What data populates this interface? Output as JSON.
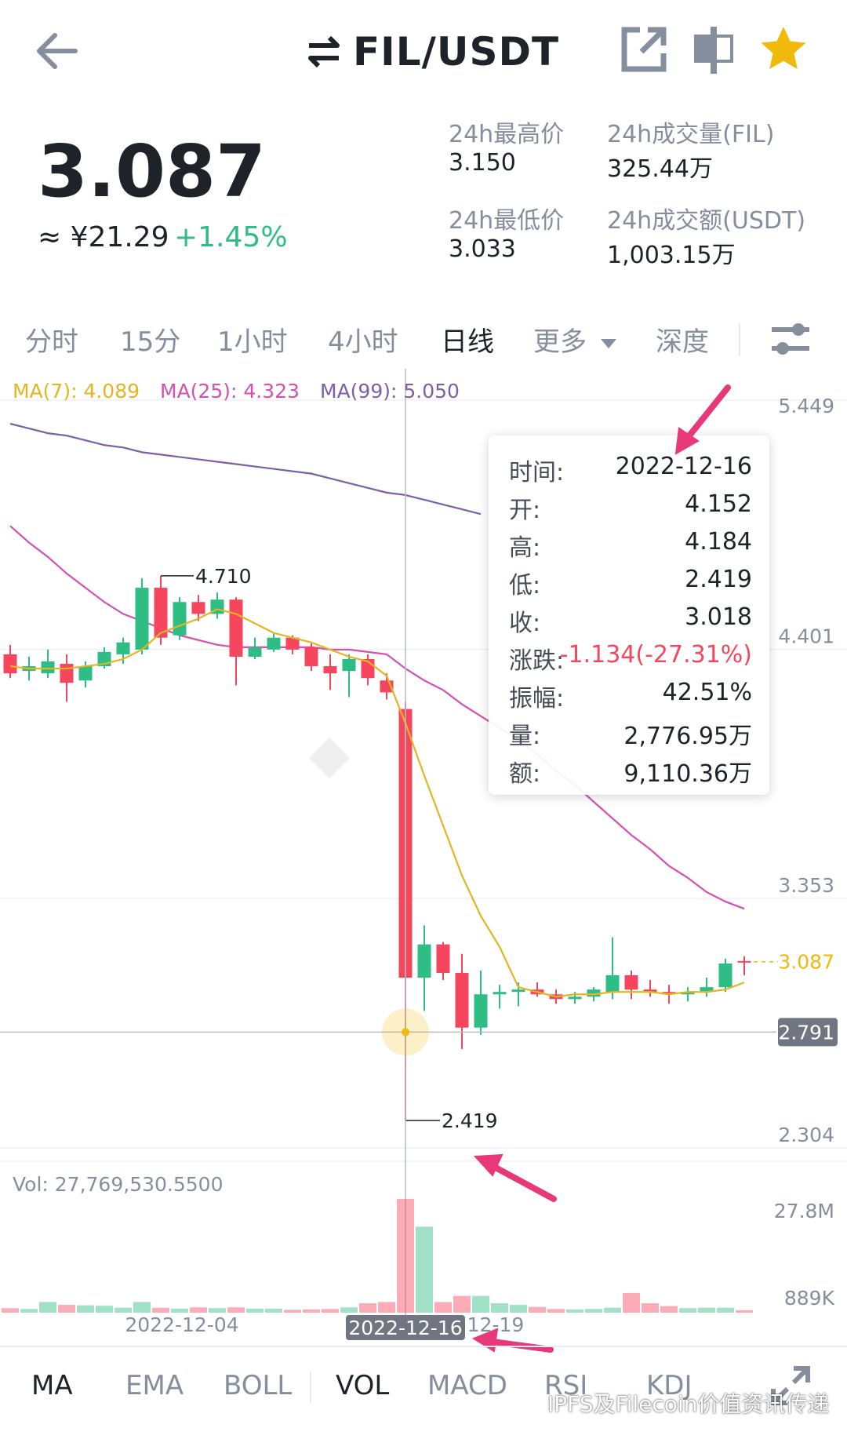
{
  "header": {
    "pair": "FIL/USDT",
    "icons": [
      "back-arrow-icon",
      "swap-icon",
      "share-icon",
      "layout-icon",
      "star-icon"
    ]
  },
  "ticker": {
    "price": "3.087",
    "cny": "≈ ¥21.29",
    "change": "+1.45%",
    "high_label": "24h最高价",
    "high": "3.150",
    "low_label": "24h最低价",
    "low": "3.033",
    "vol_label": "24h成交量(FIL)",
    "vol": "325.44万",
    "amount_label": "24h成交额(USDT)",
    "amount": "1,003.15万"
  },
  "intervals": [
    "分时",
    "15分",
    "1小时",
    "4小时",
    "日线",
    "更多",
    "深度"
  ],
  "active_interval": "日线",
  "ma_labels": {
    "ma7": "MA(7): 4.089",
    "ma25": "MA(25): 4.323",
    "ma99": "MA(99): 5.050"
  },
  "tooltip": {
    "rows": [
      {
        "k": "时间:",
        "v": "2022-12-16"
      },
      {
        "k": "开:",
        "v": "4.152"
      },
      {
        "k": "高:",
        "v": "4.184"
      },
      {
        "k": "低:",
        "v": "2.419"
      },
      {
        "k": "收:",
        "v": "3.018"
      },
      {
        "k": "涨跌:",
        "v": "-1.134(-27.31%)"
      },
      {
        "k": "振幅:",
        "v": "42.51%"
      },
      {
        "k": "量:",
        "v": "2,776.95万"
      },
      {
        "k": "额:",
        "v": "9,110.36万"
      }
    ]
  },
  "chart_data": {
    "type": "candlestick",
    "y_ticks": [
      "5.449",
      "4.401",
      "3.353",
      "2.304"
    ],
    "ylim": [
      2.304,
      5.449
    ],
    "last_price": 3.087,
    "last_price_label": "3.087",
    "cursor_price": 2.791,
    "cursor_price_label": "2.791",
    "cursor_date": "2022-12-16",
    "high_label": "4.710",
    "low_label": "2.419",
    "x_labels": [
      "2022-12-04",
      "12-19"
    ],
    "vol_label": "Vol: 27,769,530.5500",
    "vol_ticks": [
      "27.8M",
      "889K"
    ],
    "vol_max": 27.8,
    "candles": [
      {
        "o": 4.38,
        "h": 4.42,
        "l": 4.28,
        "c": 4.3
      },
      {
        "o": 4.31,
        "h": 4.37,
        "l": 4.27,
        "c": 4.33
      },
      {
        "o": 4.3,
        "h": 4.4,
        "l": 4.28,
        "c": 4.35
      },
      {
        "o": 4.34,
        "h": 4.38,
        "l": 4.18,
        "c": 4.26
      },
      {
        "o": 4.27,
        "h": 4.35,
        "l": 4.24,
        "c": 4.33
      },
      {
        "o": 4.33,
        "h": 4.41,
        "l": 4.32,
        "c": 4.39
      },
      {
        "o": 4.38,
        "h": 4.45,
        "l": 4.34,
        "c": 4.43
      },
      {
        "o": 4.4,
        "h": 4.7,
        "l": 4.38,
        "c": 4.66
      },
      {
        "o": 4.66,
        "h": 4.71,
        "l": 4.42,
        "c": 4.45
      },
      {
        "o": 4.46,
        "h": 4.62,
        "l": 4.44,
        "c": 4.6
      },
      {
        "o": 4.6,
        "h": 4.63,
        "l": 4.52,
        "c": 4.55
      },
      {
        "o": 4.55,
        "h": 4.64,
        "l": 4.53,
        "c": 4.61
      },
      {
        "o": 4.61,
        "h": 4.62,
        "l": 4.25,
        "c": 4.37
      },
      {
        "o": 4.37,
        "h": 4.45,
        "l": 4.36,
        "c": 4.41
      },
      {
        "o": 4.4,
        "h": 4.47,
        "l": 4.39,
        "c": 4.45
      },
      {
        "o": 4.45,
        "h": 4.46,
        "l": 4.38,
        "c": 4.4
      },
      {
        "o": 4.41,
        "h": 4.43,
        "l": 4.31,
        "c": 4.33
      },
      {
        "o": 4.33,
        "h": 4.38,
        "l": 4.23,
        "c": 4.3
      },
      {
        "o": 4.31,
        "h": 4.38,
        "l": 4.2,
        "c": 4.36
      },
      {
        "o": 4.36,
        "h": 4.38,
        "l": 4.25,
        "c": 4.28
      },
      {
        "o": 4.27,
        "h": 4.3,
        "l": 4.19,
        "c": 4.22
      },
      {
        "o": 4.15,
        "h": 4.18,
        "l": 2.42,
        "c": 3.02
      },
      {
        "o": 3.02,
        "h": 3.24,
        "l": 2.88,
        "c": 3.16
      },
      {
        "o": 3.16,
        "h": 3.17,
        "l": 3.01,
        "c": 3.04
      },
      {
        "o": 3.04,
        "h": 3.12,
        "l": 2.72,
        "c": 2.81
      },
      {
        "o": 2.81,
        "h": 3.05,
        "l": 2.78,
        "c": 2.95
      },
      {
        "o": 2.95,
        "h": 2.99,
        "l": 2.89,
        "c": 2.96
      },
      {
        "o": 2.96,
        "h": 3.0,
        "l": 2.9,
        "c": 2.97
      },
      {
        "o": 2.97,
        "h": 3.0,
        "l": 2.94,
        "c": 2.95
      },
      {
        "o": 2.95,
        "h": 2.97,
        "l": 2.91,
        "c": 2.93
      },
      {
        "o": 2.93,
        "h": 2.96,
        "l": 2.91,
        "c": 2.94
      },
      {
        "o": 2.94,
        "h": 2.98,
        "l": 2.92,
        "c": 2.97
      },
      {
        "o": 2.96,
        "h": 3.19,
        "l": 2.93,
        "c": 3.03
      },
      {
        "o": 3.03,
        "h": 3.05,
        "l": 2.93,
        "c": 2.97
      },
      {
        "o": 2.97,
        "h": 3.01,
        "l": 2.94,
        "c": 2.96
      },
      {
        "o": 2.96,
        "h": 2.99,
        "l": 2.91,
        "c": 2.95
      },
      {
        "o": 2.95,
        "h": 2.98,
        "l": 2.92,
        "c": 2.96
      },
      {
        "o": 2.96,
        "h": 3.02,
        "l": 2.94,
        "c": 2.98
      },
      {
        "o": 2.98,
        "h": 3.1,
        "l": 2.96,
        "c": 3.08
      },
      {
        "o": 3.09,
        "h": 3.11,
        "l": 3.03,
        "c": 3.087
      }
    ],
    "volumes": [
      1.1,
      0.9,
      2.6,
      1.9,
      1.8,
      1.7,
      1.2,
      2.6,
      1.2,
      1.0,
      1.3,
      1.1,
      1.3,
      1.0,
      1.0,
      0.7,
      0.8,
      0.9,
      1.3,
      2.3,
      2.6,
      27.8,
      21.0,
      2.6,
      4.1,
      4.1,
      2.3,
      1.9,
      1.4,
      0.9,
      0.8,
      0.9,
      1.2,
      4.8,
      2.3,
      1.6,
      1.1,
      1.2,
      1.2,
      0.6
    ],
    "ma7": [
      4.33,
      4.32,
      4.32,
      4.32,
      4.33,
      4.34,
      4.36,
      4.4,
      4.47,
      4.5,
      4.53,
      4.57,
      4.55,
      4.51,
      4.47,
      4.45,
      4.43,
      4.4,
      4.37,
      4.35,
      4.29,
      4.09,
      3.87,
      3.66,
      3.45,
      3.28,
      3.15,
      2.98,
      2.96,
      2.94,
      2.95,
      2.95,
      2.96,
      2.96,
      2.96,
      2.95,
      2.96,
      2.96,
      2.97,
      3.0
    ],
    "ma25": [
      4.92,
      4.85,
      4.79,
      4.72,
      4.66,
      4.6,
      4.55,
      4.52,
      4.49,
      4.46,
      4.44,
      4.42,
      4.41,
      4.41,
      4.41,
      4.41,
      4.41,
      4.4,
      4.4,
      4.39,
      4.38,
      4.32,
      4.27,
      4.23,
      4.17,
      4.12,
      4.07,
      4.02,
      3.96,
      3.89,
      3.83,
      3.76,
      3.69,
      3.62,
      3.56,
      3.49,
      3.44,
      3.38,
      3.34,
      3.31
    ],
    "ma99": [
      5.35,
      5.33,
      5.31,
      5.3,
      5.28,
      5.26,
      5.25,
      5.23,
      5.22,
      5.21,
      5.2,
      5.19,
      5.18,
      5.17,
      5.16,
      5.15,
      5.14,
      5.12,
      5.1,
      5.08,
      5.06,
      5.05,
      5.03,
      5.01,
      4.99,
      4.97
    ]
  },
  "indicators": [
    "MA",
    "EMA",
    "BOLL",
    "VOL",
    "MACD",
    "RSI",
    "KDJ"
  ],
  "active_indicators": [
    "MA",
    "VOL"
  ],
  "watermark": "IPFS及Filecoin价值资讯传递",
  "colors": {
    "up": "#2ebd85",
    "down": "#f6465d",
    "ma7": "#e2b623",
    "ma25": "#d64fb2",
    "ma99": "#7d5fa8",
    "arrow": "#e8387a"
  }
}
